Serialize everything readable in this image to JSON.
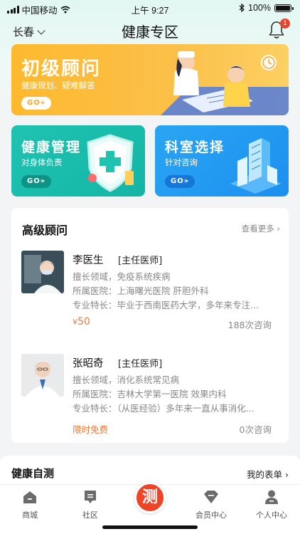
{
  "status_bar": {
    "carrier": "中国移动",
    "time": "上午 9:27",
    "battery": "100%"
  },
  "header": {
    "city": "长春",
    "title": "健康专区",
    "notification_count": "1"
  },
  "banners": {
    "main": {
      "title": "初级顾问",
      "subtitle": "健康规划、疑难解答",
      "go": "GO»"
    },
    "left": {
      "title": "健康管理",
      "subtitle": "对身体负责",
      "go": "GO»"
    },
    "right": {
      "title": "科室选择",
      "subtitle": "针对咨询",
      "go": "GO»"
    }
  },
  "advisors": {
    "title": "高级顾问",
    "more": "查看更多 ›",
    "doctors": [
      {
        "name": "李医生",
        "rank": "[主任医师]",
        "field": "擅长领域，免疫系统疾病",
        "hospital": "所属医院：上海曙光医院 肝胆外科",
        "specialty": "专业特长：毕业于西南医药大学，多年来专注...",
        "price_symbol": "¥",
        "price": "50",
        "consult_count": "188次咨询"
      },
      {
        "name": "张昭奇",
        "rank": "[主任医师]",
        "field": "擅长领域，消化系统常见病",
        "hospital": "所属医院：吉林大学第一医院 效果内科",
        "specialty": "专业特长：（从医经验）多年来一直从事消化...",
        "free_label": "限时免费",
        "consult_count": "0次咨询"
      }
    ]
  },
  "self_test": {
    "title": "健康自测",
    "link": "我的表单 ›"
  },
  "tabbar": {
    "items": [
      {
        "label": "商城",
        "icon": "home-icon"
      },
      {
        "label": "社区",
        "icon": "community-icon"
      },
      {
        "label": "测",
        "icon": "test-icon"
      },
      {
        "label": "会员中心",
        "icon": "member-icon"
      },
      {
        "label": "个人中心",
        "icon": "profile-icon"
      }
    ]
  },
  "colors": {
    "accent_orange": "#f07a3a",
    "banner_yellow": "#fdb92f",
    "banner_teal": "#1fc3b0",
    "banner_blue": "#29a6f3",
    "tab_center_red": "#ee4428"
  }
}
